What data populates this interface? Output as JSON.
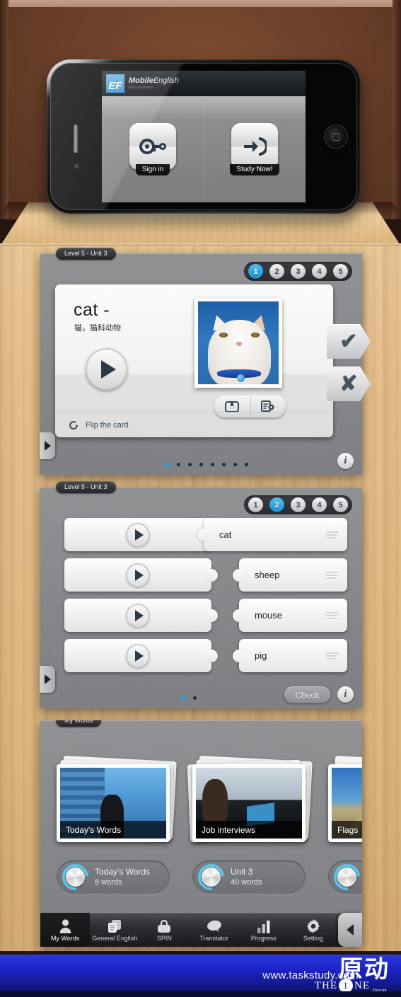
{
  "phone": {
    "brand": "EF",
    "app_title_bold": "Mobile",
    "app_title_light": "English",
    "app_tagline": "learn anywhere",
    "buttons": [
      {
        "label": "Sign in",
        "icon": "key-icon"
      },
      {
        "label": "Study Now!",
        "icon": "arrow-into-door-icon"
      }
    ]
  },
  "panel1": {
    "label": "Level 5 - Unit 3",
    "steps": [
      {
        "n": "1",
        "active": true
      },
      {
        "n": "2",
        "active": false
      },
      {
        "n": "3",
        "active": false
      },
      {
        "n": "4",
        "active": false
      },
      {
        "n": "5",
        "active": false
      }
    ],
    "card": {
      "word": "cat  -",
      "translation": "猫，猫科动物",
      "play_icon": "play-icon",
      "photo_alt": "white cat with blue collar",
      "icons": [
        "picture-bookmark-icon",
        "document-search-icon"
      ],
      "flip_label": "Flip the card",
      "flip_icon": "refresh-icon",
      "yes_glyph": "✔",
      "no_glyph": "✘"
    },
    "dots": {
      "count": 8,
      "active": 0
    },
    "info_glyph": "i",
    "side_tab_icon": "chevron-right-icon"
  },
  "panel2": {
    "label": "Level 5 - Unit 3",
    "steps": [
      {
        "n": "1",
        "active": false
      },
      {
        "n": "2",
        "active": true
      },
      {
        "n": "3",
        "active": false
      },
      {
        "n": "4",
        "active": false
      },
      {
        "n": "5",
        "active": false
      }
    ],
    "rows": [
      {
        "word": "cat",
        "connected": true
      },
      {
        "word": "sheep",
        "connected": false
      },
      {
        "word": "mouse",
        "connected": false
      },
      {
        "word": "pig",
        "connected": false
      }
    ],
    "check_label": "Check",
    "dots": {
      "count": 2,
      "active": 0
    },
    "info_glyph": "i",
    "side_tab_icon": "chevron-right-icon"
  },
  "panel3": {
    "label": "My Words",
    "decks": [
      {
        "caption": "Today's Words",
        "art": "img-success"
      },
      {
        "caption": "Job interviews",
        "art": "img-interview"
      },
      {
        "caption": "Flags",
        "art": "img-flags"
      }
    ],
    "dials": [
      {
        "title": "Today's Words",
        "subtitle": "8  words"
      },
      {
        "title": "Unit  3",
        "subtitle": "40 words"
      },
      {
        "title": "",
        "subtitle": ""
      }
    ],
    "tabs": [
      {
        "label": "My Words",
        "icon": "person-icon",
        "active": true
      },
      {
        "label": "General English",
        "icon": "documents-icon",
        "active": false
      },
      {
        "label": "SPIN",
        "icon": "basket-icon",
        "active": false
      },
      {
        "label": "Transtator",
        "icon": "speech-bubble-icon",
        "active": false
      },
      {
        "label": "Progress",
        "icon": "bar-chart-icon",
        "active": false
      },
      {
        "label": "Setting",
        "icon": "gear-icon",
        "active": false
      }
    ],
    "tab_arrow_icon": "chevron-left-icon"
  },
  "footer": {
    "url": "www.taskstudy.com",
    "logo_cn": "原动",
    "logo_the": "THE",
    "logo_one_num": "1",
    "logo_ne": "NE",
    "logo_design": "Design"
  },
  "colors": {
    "accent_blue": "#22a6e8",
    "panel_gray": "#87898c",
    "footer_blue": "#1b24c4",
    "dial_ring": "#5bc6f0"
  }
}
